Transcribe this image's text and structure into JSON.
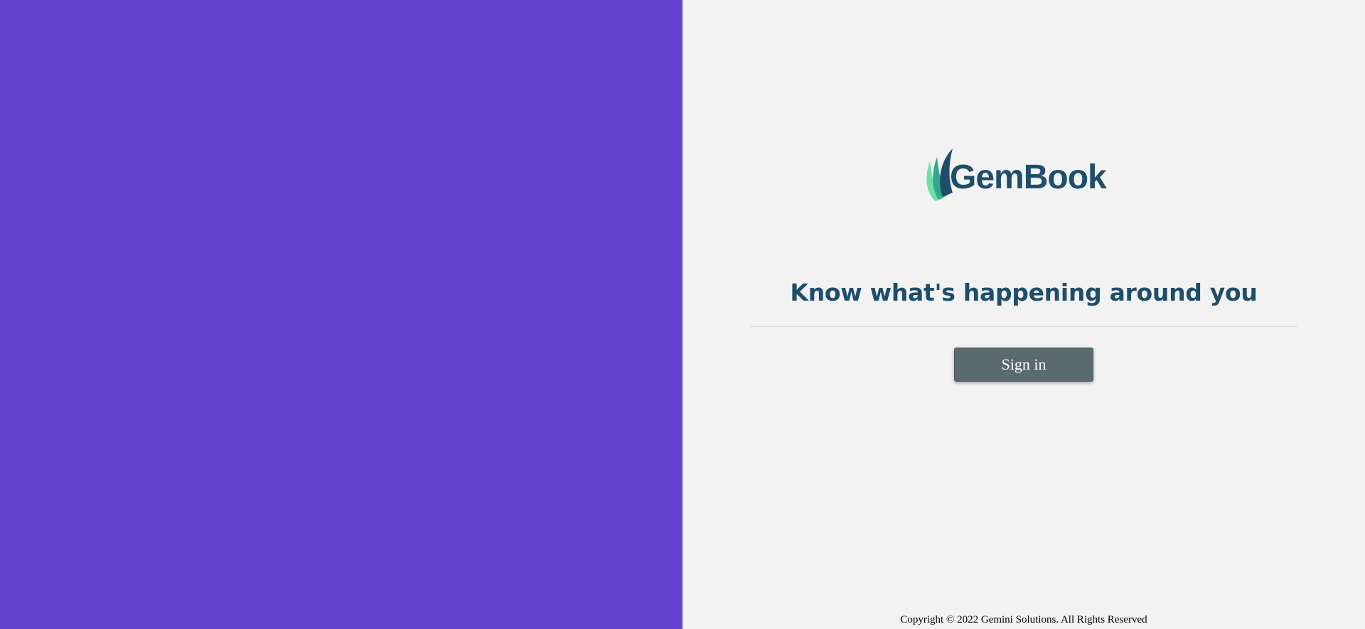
{
  "colors": {
    "left_panel_bg": "#6443d1",
    "right_panel_bg": "#f2f2f2",
    "brand": "#1f4e6b",
    "logo_leaf_light": "#6fe0a3",
    "logo_leaf_dark": "#1f4e6b",
    "button_bg": "#5a6a6e"
  },
  "brand": {
    "logo_text": "GemBook",
    "logo_icon": "leaf-icon"
  },
  "hero": {
    "tagline": "Know what's happening around you"
  },
  "actions": {
    "signin_label": "Sign in"
  },
  "footer": {
    "copyright": "Copyright © 2022 Gemini Solutions. All Rights Reserved"
  }
}
